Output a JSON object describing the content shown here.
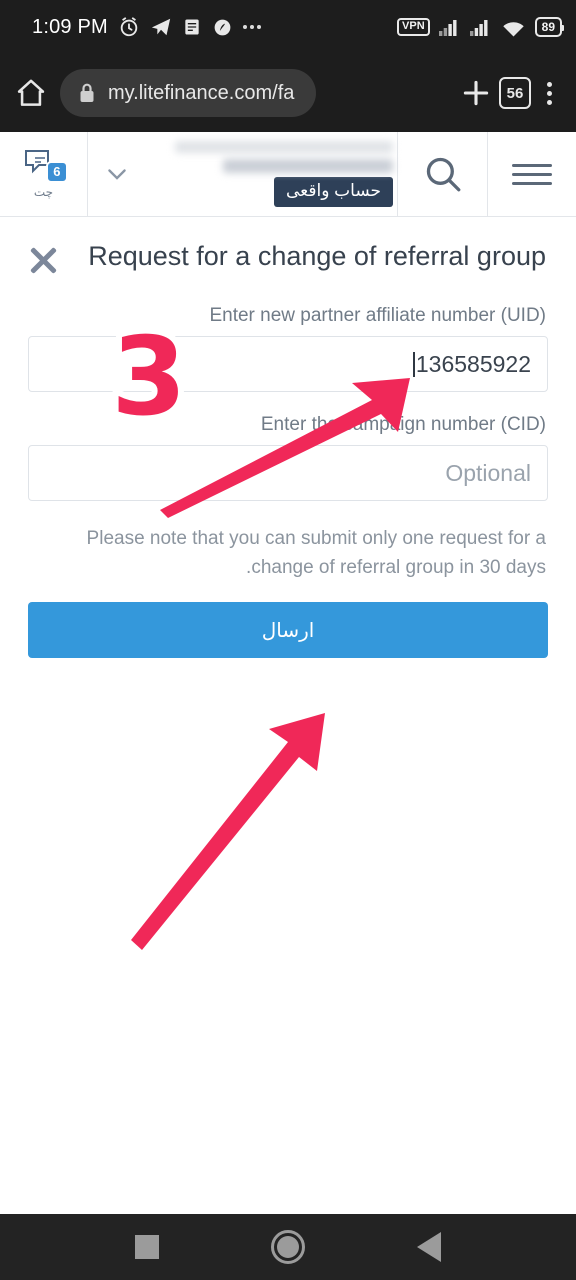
{
  "statusbar": {
    "time": "1:09 PM",
    "icons": [
      "alarm-icon",
      "telegram-icon",
      "notes-icon",
      "app-icon",
      "more-icon"
    ],
    "vpn_label": "VPN",
    "battery_level": "89"
  },
  "browser": {
    "home_icon": "home-icon",
    "lock_icon": "lock-icon",
    "url": "my.litefinance.com/fa",
    "new_tab_icon": "plus-icon",
    "tab_count": "56",
    "menu_icon": "kebab-menu-icon"
  },
  "site_header": {
    "chat_label": "چت",
    "chat_badge": "6",
    "chevron_icon": "chevron-down-icon",
    "account_badge": "حساب واقعی",
    "search_icon": "search-icon",
    "menu_icon": "hamburger-icon"
  },
  "modal": {
    "close_icon": "close-icon",
    "title": "Request for a change of referral group",
    "uid_label": "Enter new partner affiliate number (UID)",
    "uid_value": "136585922",
    "cid_label": "Enter the campaign number (CID)",
    "cid_placeholder": "Optional",
    "note": "Please note that you can submit only one request for a change of referral group in 30 days.",
    "submit_label": "ارسال"
  },
  "annotations": {
    "step_number": "3",
    "accent_pink": "#f02858",
    "arrow_uid": "arrow-to-uid-field",
    "arrow_submit": "arrow-to-submit-button"
  },
  "navbar": {
    "recents_icon": "square-recents-icon",
    "home_icon": "circle-home-icon",
    "back_icon": "triangle-back-icon"
  },
  "colors": {
    "button_blue": "#3498db",
    "badge_navy": "#2e4058",
    "chat_blue": "#3b8fd4"
  }
}
